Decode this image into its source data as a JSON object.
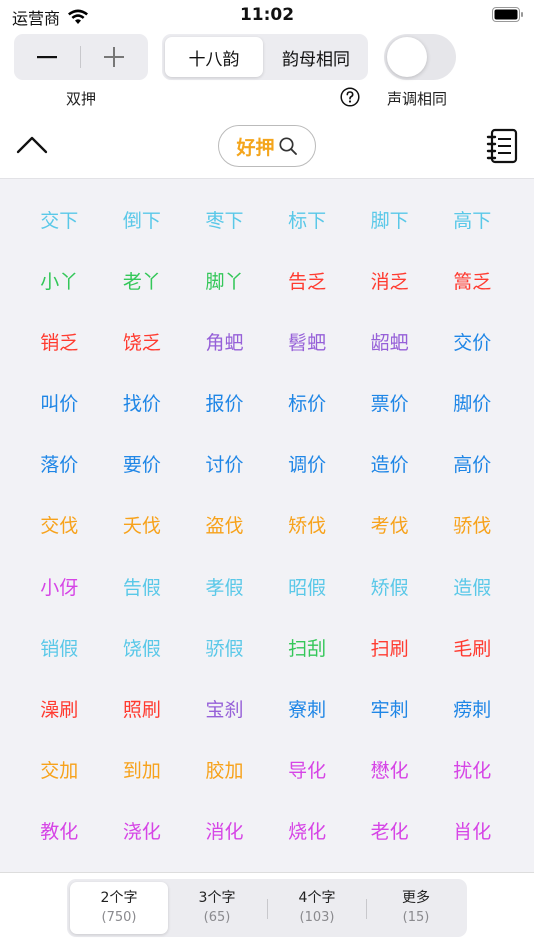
{
  "status_bar": {
    "carrier": "运营商",
    "time": "11:02"
  },
  "controls": {
    "stepper_minus": "−",
    "stepper_plus": "+",
    "stepper_label": "双押",
    "segments": [
      "十八韵",
      "韵母相同"
    ],
    "toggle_label": "声调相同",
    "toggle_on": false
  },
  "search": {
    "label": "好押"
  },
  "colors": {
    "cyan": "#5ac8e8",
    "green": "#34c759",
    "red": "#ff3b30",
    "purple": "#9660d8",
    "blue": "#1f86e6",
    "orange": "#f7a21b",
    "magenta": "#d645e6",
    "accent": "#f4a51c"
  },
  "rhymes": [
    {
      "text": "交下",
      "color": "cyan"
    },
    {
      "text": "倒下",
      "color": "cyan"
    },
    {
      "text": "枣下",
      "color": "cyan"
    },
    {
      "text": "标下",
      "color": "cyan"
    },
    {
      "text": "脚下",
      "color": "cyan"
    },
    {
      "text": "高下",
      "color": "cyan"
    },
    {
      "text": "小丫",
      "color": "green"
    },
    {
      "text": "老丫",
      "color": "green"
    },
    {
      "text": "脚丫",
      "color": "green"
    },
    {
      "text": "告乏",
      "color": "red"
    },
    {
      "text": "消乏",
      "color": "red"
    },
    {
      "text": "篙乏",
      "color": "red"
    },
    {
      "text": "销乏",
      "color": "red"
    },
    {
      "text": "饶乏",
      "color": "red"
    },
    {
      "text": "角蚆",
      "color": "purple"
    },
    {
      "text": "髫蚆",
      "color": "purple"
    },
    {
      "text": "龆蚆",
      "color": "purple"
    },
    {
      "text": "交价",
      "color": "blue"
    },
    {
      "text": "叫价",
      "color": "blue"
    },
    {
      "text": "找价",
      "color": "blue"
    },
    {
      "text": "报价",
      "color": "blue"
    },
    {
      "text": "标价",
      "color": "blue"
    },
    {
      "text": "票价",
      "color": "blue"
    },
    {
      "text": "脚价",
      "color": "blue"
    },
    {
      "text": "落价",
      "color": "blue"
    },
    {
      "text": "要价",
      "color": "blue"
    },
    {
      "text": "讨价",
      "color": "blue"
    },
    {
      "text": "调价",
      "color": "blue"
    },
    {
      "text": "造价",
      "color": "blue"
    },
    {
      "text": "高价",
      "color": "blue"
    },
    {
      "text": "交伐",
      "color": "orange"
    },
    {
      "text": "夭伐",
      "color": "orange"
    },
    {
      "text": "盗伐",
      "color": "orange"
    },
    {
      "text": "矫伐",
      "color": "orange"
    },
    {
      "text": "考伐",
      "color": "orange"
    },
    {
      "text": "骄伐",
      "color": "orange"
    },
    {
      "text": "小伢",
      "color": "magenta"
    },
    {
      "text": "告假",
      "color": "cyan"
    },
    {
      "text": "孝假",
      "color": "cyan"
    },
    {
      "text": "昭假",
      "color": "cyan"
    },
    {
      "text": "矫假",
      "color": "cyan"
    },
    {
      "text": "造假",
      "color": "cyan"
    },
    {
      "text": "销假",
      "color": "cyan"
    },
    {
      "text": "饶假",
      "color": "cyan"
    },
    {
      "text": "骄假",
      "color": "cyan"
    },
    {
      "text": "扫刮",
      "color": "green"
    },
    {
      "text": "扫刷",
      "color": "red"
    },
    {
      "text": "毛刷",
      "color": "red"
    },
    {
      "text": "澡刷",
      "color": "red"
    },
    {
      "text": "照刷",
      "color": "red"
    },
    {
      "text": "宝刹",
      "color": "purple"
    },
    {
      "text": "寮刺",
      "color": "blue"
    },
    {
      "text": "牢刺",
      "color": "blue"
    },
    {
      "text": "痨刺",
      "color": "blue"
    },
    {
      "text": "交加",
      "color": "orange"
    },
    {
      "text": "到加",
      "color": "orange"
    },
    {
      "text": "胶加",
      "color": "orange"
    },
    {
      "text": "导化",
      "color": "magenta"
    },
    {
      "text": "懋化",
      "color": "magenta"
    },
    {
      "text": "扰化",
      "color": "magenta"
    },
    {
      "text": "教化",
      "color": "magenta"
    },
    {
      "text": "浇化",
      "color": "magenta"
    },
    {
      "text": "消化",
      "color": "magenta"
    },
    {
      "text": "烧化",
      "color": "magenta"
    },
    {
      "text": "老化",
      "color": "magenta"
    },
    {
      "text": "肖化",
      "color": "magenta"
    }
  ],
  "tabs": [
    {
      "label": "2个字",
      "count": "(750)"
    },
    {
      "label": "3个字",
      "count": "(65)"
    },
    {
      "label": "4个字",
      "count": "(103)"
    },
    {
      "label": "更多",
      "count": "(15)"
    }
  ]
}
